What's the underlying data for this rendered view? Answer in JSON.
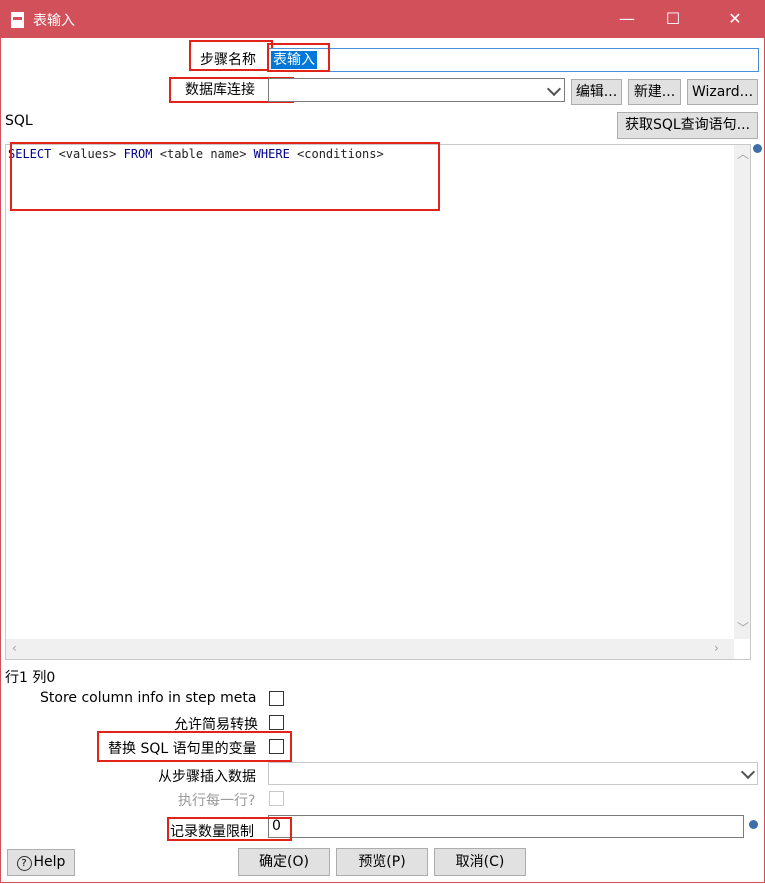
{
  "window": {
    "title": "表输入",
    "minimize": "—",
    "maximize": "☐",
    "close": "✕"
  },
  "step_name": {
    "label": "步骤名称",
    "value": "表输入"
  },
  "db_connection": {
    "label": "数据库连接",
    "value": "",
    "edit_button": "编辑...",
    "new_button": "新建...",
    "wizard_button": "Wizard..."
  },
  "sql": {
    "label": "SQL",
    "get_sql_button": "获取SQL查询语句...",
    "tokens": [
      "SELECT",
      " <values> ",
      "FROM",
      " <table name> ",
      "WHERE",
      " <conditions>"
    ]
  },
  "position": "行1 列0",
  "options": {
    "store_column_info": {
      "label": "Store column info in step meta",
      "checked": false
    },
    "lazy_conversion": {
      "label": "允许简易转换",
      "checked": false
    },
    "replace_variables": {
      "label": "替换 SQL 语句里的变量",
      "checked": false
    },
    "insert_from_step": {
      "label": "从步骤插入数据",
      "value": ""
    },
    "execute_each_row": {
      "label": "执行每一行?",
      "checked": false,
      "enabled": false
    },
    "limit": {
      "label": "记录数量限制",
      "value": "0"
    }
  },
  "footer": {
    "help": "Help",
    "ok": "确定(O)",
    "preview": "预览(P)",
    "cancel": "取消(C)"
  }
}
